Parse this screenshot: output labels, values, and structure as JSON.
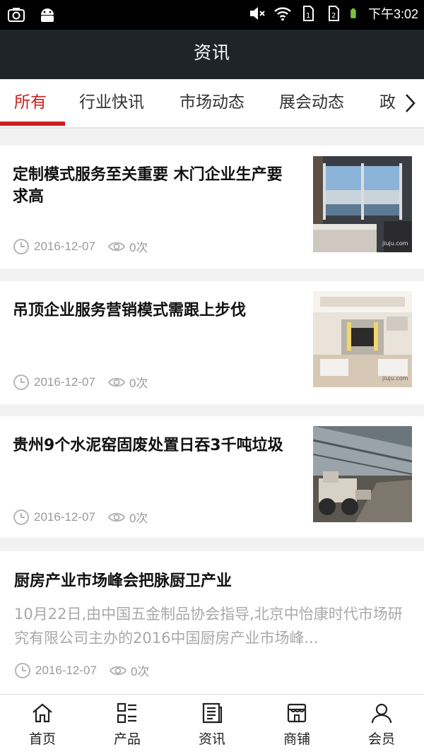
{
  "status_bar": {
    "time": "下午3:02",
    "icons": [
      "screenshot-icon",
      "android-icon",
      "mute-icon",
      "wifi-icon",
      "sim1-icon",
      "sim2-icon",
      "battery-icon"
    ]
  },
  "header": {
    "title": "资讯"
  },
  "tabs": [
    {
      "label": "所有",
      "active": true
    },
    {
      "label": "行业快讯",
      "active": false
    },
    {
      "label": "市场动态",
      "active": false
    },
    {
      "label": "展会动态",
      "active": false
    },
    {
      "label": "政",
      "active": false
    }
  ],
  "articles": [
    {
      "title": "定制模式服务至关重要 木门企业生产要求高",
      "date": "2016-12-07",
      "views": "0次",
      "thumb_icon": "bedroom-ocean-view-image"
    },
    {
      "title": "吊顶企业服务营销模式需跟上步伐",
      "date": "2016-12-07",
      "views": "0次",
      "thumb_icon": "living-room-ceiling-image"
    },
    {
      "title": "贵州9个水泥窑固废处置日吞3千吨垃圾",
      "date": "2016-12-07",
      "views": "0次",
      "thumb_icon": "loader-warehouse-image"
    },
    {
      "title": "厨房产业市场峰会把脉厨卫产业",
      "summary": "10月22日,由中国五金制品协会指导,北京中怡康时代市场研究有限公司主办的2016中国厨房产业市场峰...",
      "date": "2016-12-07",
      "views": "0次"
    }
  ],
  "bottom_nav": [
    {
      "label": "首页",
      "icon": "home-icon"
    },
    {
      "label": "产品",
      "icon": "product-grid-icon"
    },
    {
      "label": "资讯",
      "icon": "news-icon"
    },
    {
      "label": "商铺",
      "icon": "shop-icon"
    },
    {
      "label": "会员",
      "icon": "member-icon"
    }
  ],
  "colors": {
    "accent": "#cc1f1f",
    "header_bg": "#1e2428",
    "meta_text": "#9a9a9a"
  }
}
